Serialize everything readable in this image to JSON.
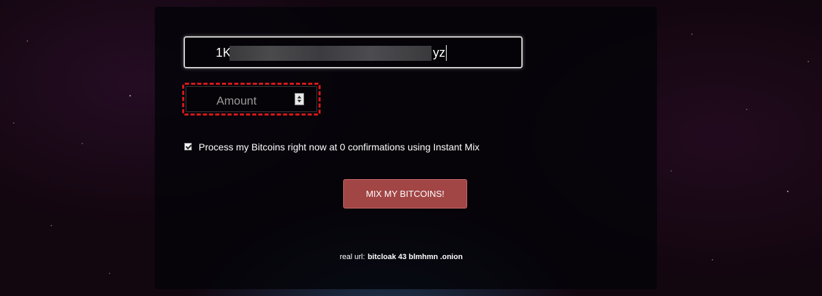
{
  "address_field": {
    "prefix": "1K",
    "suffix": "yz"
  },
  "amount_field": {
    "placeholder": "Amount"
  },
  "instant_mix": {
    "checked": true,
    "label": "Process my Bitcoins right now at 0 confirmations using Instant Mix"
  },
  "mix_button": {
    "label": "MIX MY BITCOINS!"
  },
  "footer": {
    "real_url_label": "real url:",
    "real_url_value": "bitcloak 43 blmhmn .onion"
  },
  "colors": {
    "button_bg": "#a24545",
    "highlight_border": "#d81818",
    "panel_bg": "#050307"
  },
  "icons": [
    "spinner-arrows-icon",
    "checkmark-icon"
  ]
}
